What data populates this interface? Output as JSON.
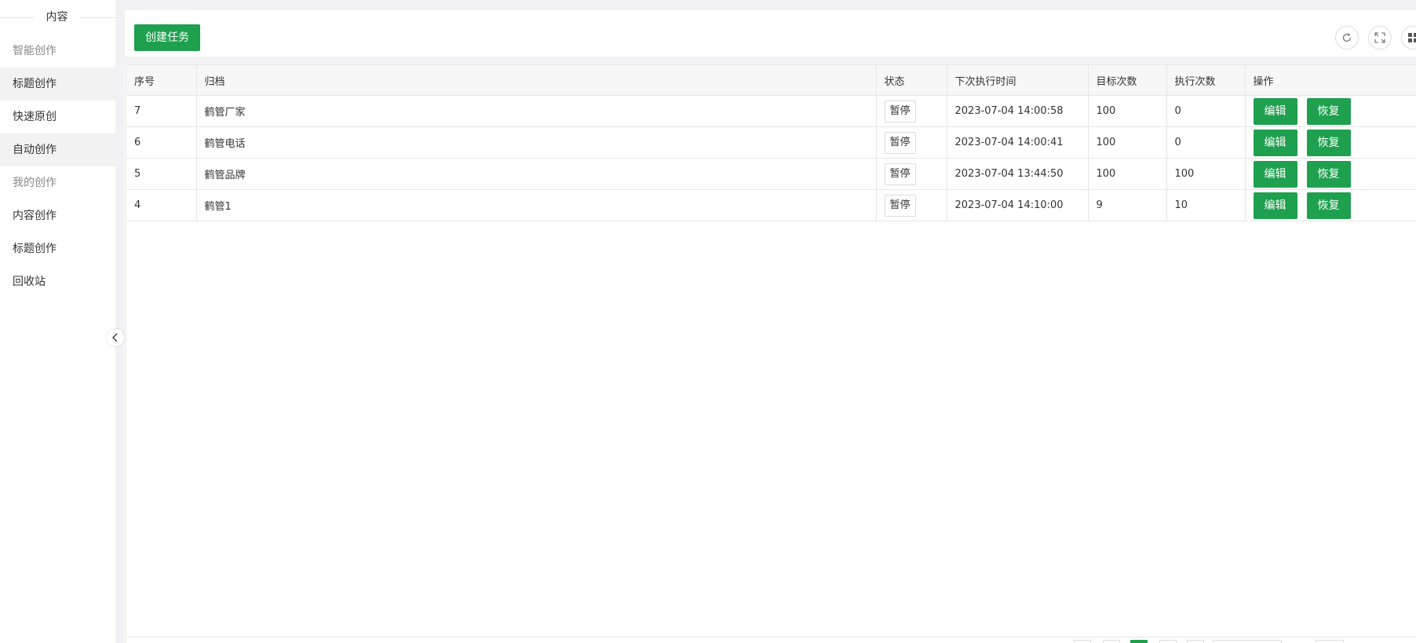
{
  "sidebar": {
    "section_title": "内容",
    "items": [
      {
        "label": "智能创作",
        "type": "group"
      },
      {
        "label": "标题创作",
        "type": "item",
        "active": true
      },
      {
        "label": "快速原创",
        "type": "item"
      },
      {
        "label": "自动创作",
        "type": "item",
        "active": true
      },
      {
        "label": "我的创作",
        "type": "group"
      },
      {
        "label": "内容创作",
        "type": "item"
      },
      {
        "label": "标题创作",
        "type": "item"
      },
      {
        "label": "回收站",
        "type": "item"
      }
    ]
  },
  "toolbar": {
    "create_label": "创建任务",
    "icons": [
      "refresh-icon",
      "fullscreen-icon",
      "columns-icon"
    ]
  },
  "table": {
    "headers": [
      "序号",
      "归档",
      "状态",
      "下次执行时间",
      "目标次数",
      "执行次数",
      "操作"
    ],
    "rows": [
      {
        "id": "7",
        "archive": "鹤管厂家",
        "status": "暂停",
        "next_time": "2023-07-04 14:00:58",
        "target": "100",
        "executed": "0",
        "edit": "编辑",
        "resume": "恢复"
      },
      {
        "id": "6",
        "archive": "鹤管电话",
        "status": "暂停",
        "next_time": "2023-07-04 14:00:41",
        "target": "100",
        "executed": "0",
        "edit": "编辑",
        "resume": "恢复"
      },
      {
        "id": "5",
        "archive": "鹤管品牌",
        "status": "暂停",
        "next_time": "2023-07-04 13:44:50",
        "target": "100",
        "executed": "100",
        "edit": "编辑",
        "resume": "恢复"
      },
      {
        "id": "4",
        "archive": "鹤管1",
        "status": "暂停",
        "next_time": "2023-07-04 14:10:00",
        "target": "9",
        "executed": "10",
        "edit": "编辑",
        "resume": "恢复"
      }
    ]
  },
  "colors": {
    "primary": "#1ea04f",
    "page_bg": "#f2f2f5",
    "header_bg": "#f7f7f7",
    "border": "#e6e6e6"
  }
}
